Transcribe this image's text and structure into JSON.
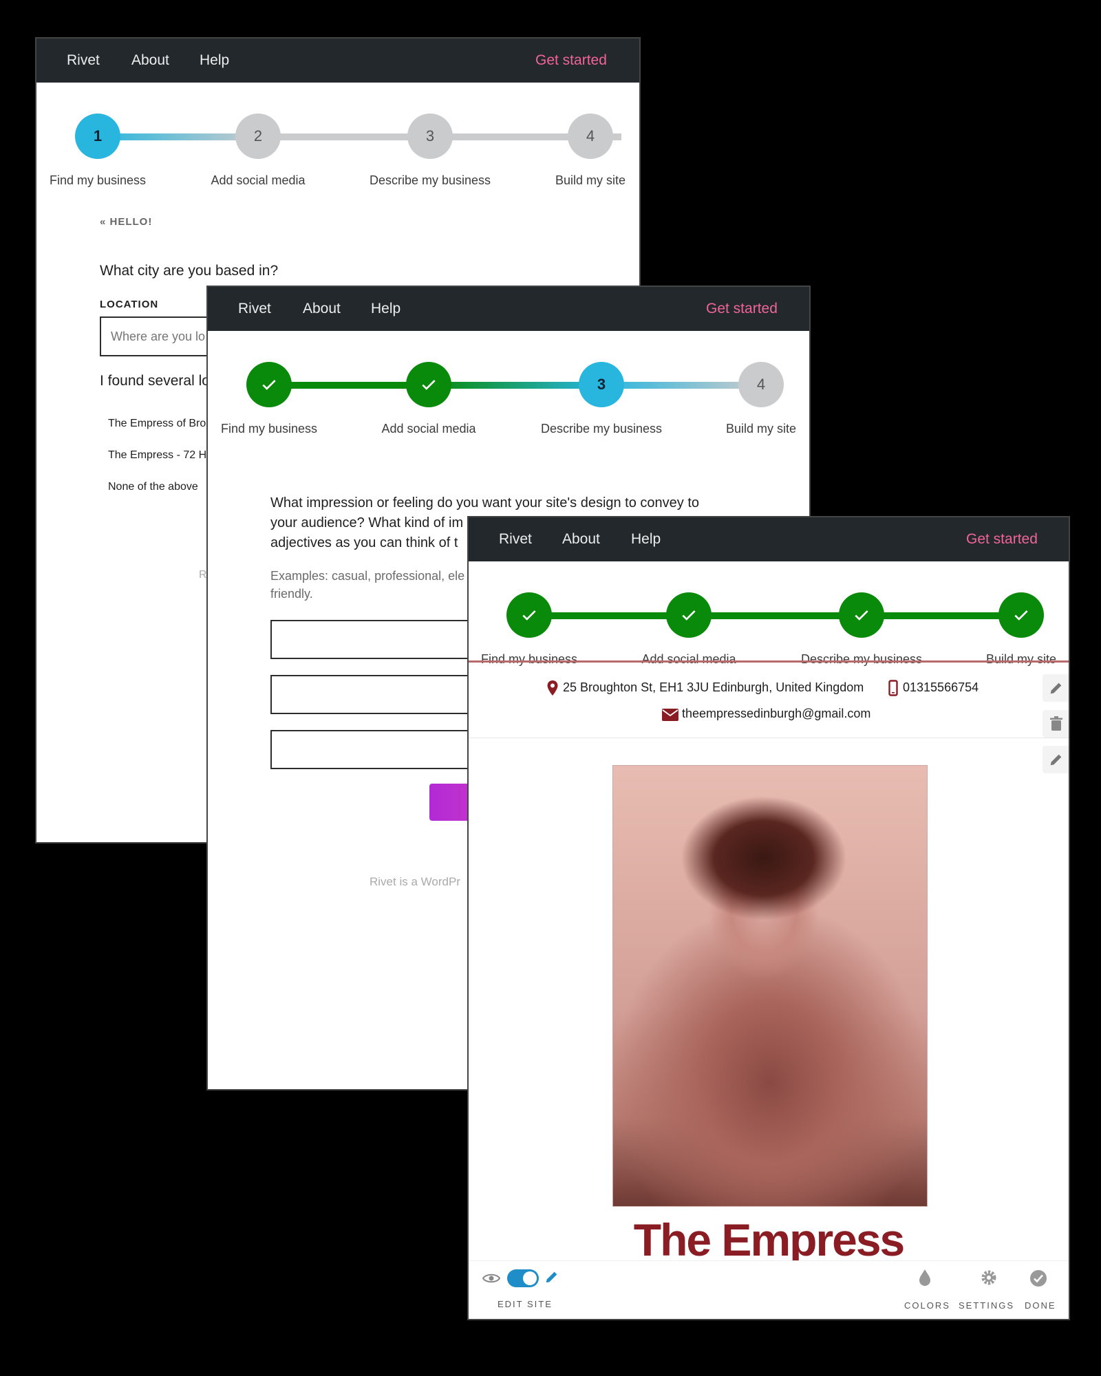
{
  "nav": {
    "brand": "Rivet",
    "about": "About",
    "help": "Help",
    "cta": "Get started"
  },
  "steps": [
    "Find my business",
    "Add social media",
    "Describe my business",
    "Build my site"
  ],
  "step_numbers": [
    "1",
    "2",
    "3",
    "4"
  ],
  "colors": {
    "navbar": "#23282d",
    "cta": "#f0649a",
    "active_step": "#29b6de",
    "done_step": "#0a8a0a",
    "todo_step": "#c9cbcd",
    "brand_red": "#8a1c24",
    "accent_purple": "#b22ad6"
  },
  "window1": {
    "back_link": "« HELLO!",
    "question": "What city are you based in?",
    "location_label": "LOCATION",
    "location_placeholder": "Where are you lo",
    "found_text": "I found several lo",
    "options": [
      "The Empress of Bro",
      "The Empress - 72 H",
      "None of the above"
    ],
    "footer_fragment": "R"
  },
  "window2": {
    "question_line1": "What impression or feeling do you want your site's design to convey to",
    "question_line2": "your audience? What kind of im",
    "question_line3": "adjectives as you can think of t",
    "hint_line1": "Examples: casual, professional, ele",
    "hint_line2": "friendly.",
    "footer_fragment": "Rivet is a WordPr"
  },
  "window3": {
    "address": "25 Broughton St, EH1 3JU Edinburgh, United Kingdom",
    "phone": "01315566754",
    "email": "theempressedinburgh@gmail.com",
    "site_title": "The Empress",
    "edit_site_label": "EDIT SITE",
    "colors_label": "COLORS",
    "settings_label": "SETTINGS",
    "done_label": "DONE"
  }
}
